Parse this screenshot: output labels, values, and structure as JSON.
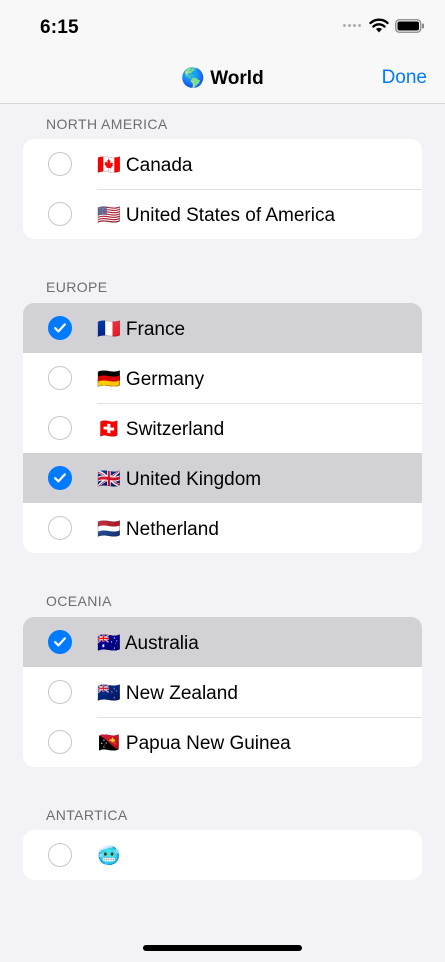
{
  "status_bar": {
    "time": "6:15"
  },
  "nav": {
    "title": "🌎 World",
    "done_label": "Done"
  },
  "sections": [
    {
      "header": "NORTH AMERICA",
      "items": [
        {
          "label": "🇨🇦 Canada",
          "selected": false
        },
        {
          "label": "🇺🇸 United States of America",
          "selected": false
        }
      ]
    },
    {
      "header": "EUROPE",
      "items": [
        {
          "label": "🇫🇷 France",
          "selected": true
        },
        {
          "label": "🇩🇪 Germany",
          "selected": false
        },
        {
          "label": "🇨🇭 Switzerland",
          "selected": false
        },
        {
          "label": "🇬🇧 United Kingdom",
          "selected": true
        },
        {
          "label": "🇳🇱 Netherland",
          "selected": false
        }
      ]
    },
    {
      "header": "OCEANIA",
      "items": [
        {
          "label": "🇦🇺 Australia",
          "selected": true
        },
        {
          "label": "🇳🇿 New Zealand",
          "selected": false
        },
        {
          "label": "🇵🇬 Papua New Guinea",
          "selected": false
        }
      ]
    },
    {
      "header": "ANTARTICA",
      "items": [
        {
          "label": "🥶",
          "selected": false
        }
      ]
    }
  ],
  "colors": {
    "accent": "#007aff",
    "selected_row": "#d1d1d6",
    "background": "#f2f2f7"
  }
}
